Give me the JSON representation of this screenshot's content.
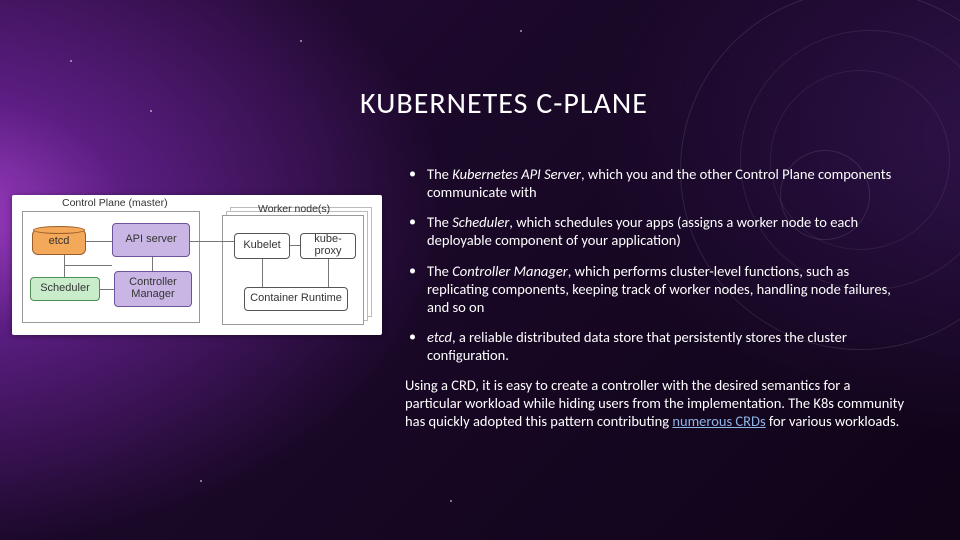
{
  "title": "KUBERNETES C-PLANE",
  "bullets": [
    {
      "term": "Kubernetes API Server",
      "rest": ", which you and the other Control Plane components communicate with"
    },
    {
      "term": "Scheduler",
      "rest": ", which schedules your apps (assigns a worker node to each deployable component of your application)"
    },
    {
      "term": "Controller Manager",
      "rest": ", which performs cluster-level functions, such as replicating components, keeping track of worker nodes, handling node failures, and so on"
    },
    {
      "term": "etcd",
      "rest": ", a reliable distributed data store that persistently stores the cluster configuration.",
      "term_only_italic": true
    }
  ],
  "footnote": {
    "pre": "Using a CRD, it is easy to create a controller with the desired semantics for a particular workload while hiding users from the implementation. The K8s community has quickly adopted this pattern contributing ",
    "link_text": "numerous CRDs",
    "post": " for various workloads."
  },
  "diagram": {
    "labels": {
      "control_plane": "Control Plane (master)",
      "worker_nodes": "Worker node(s)"
    },
    "boxes": {
      "etcd": "etcd",
      "api_server": "API server",
      "scheduler": "Scheduler",
      "controller_manager": "Controller Manager",
      "kubelet": "Kubelet",
      "kube_proxy": "kube-proxy",
      "container_runtime": "Container Runtime"
    },
    "colors": {
      "etcd_fill": "#f3a85a",
      "api_fill": "#c9b6e4",
      "scheduler_fill": "#c9eccb",
      "controller_fill": "#c9b6e4",
      "worker_box_fill": "#ffffff"
    }
  }
}
